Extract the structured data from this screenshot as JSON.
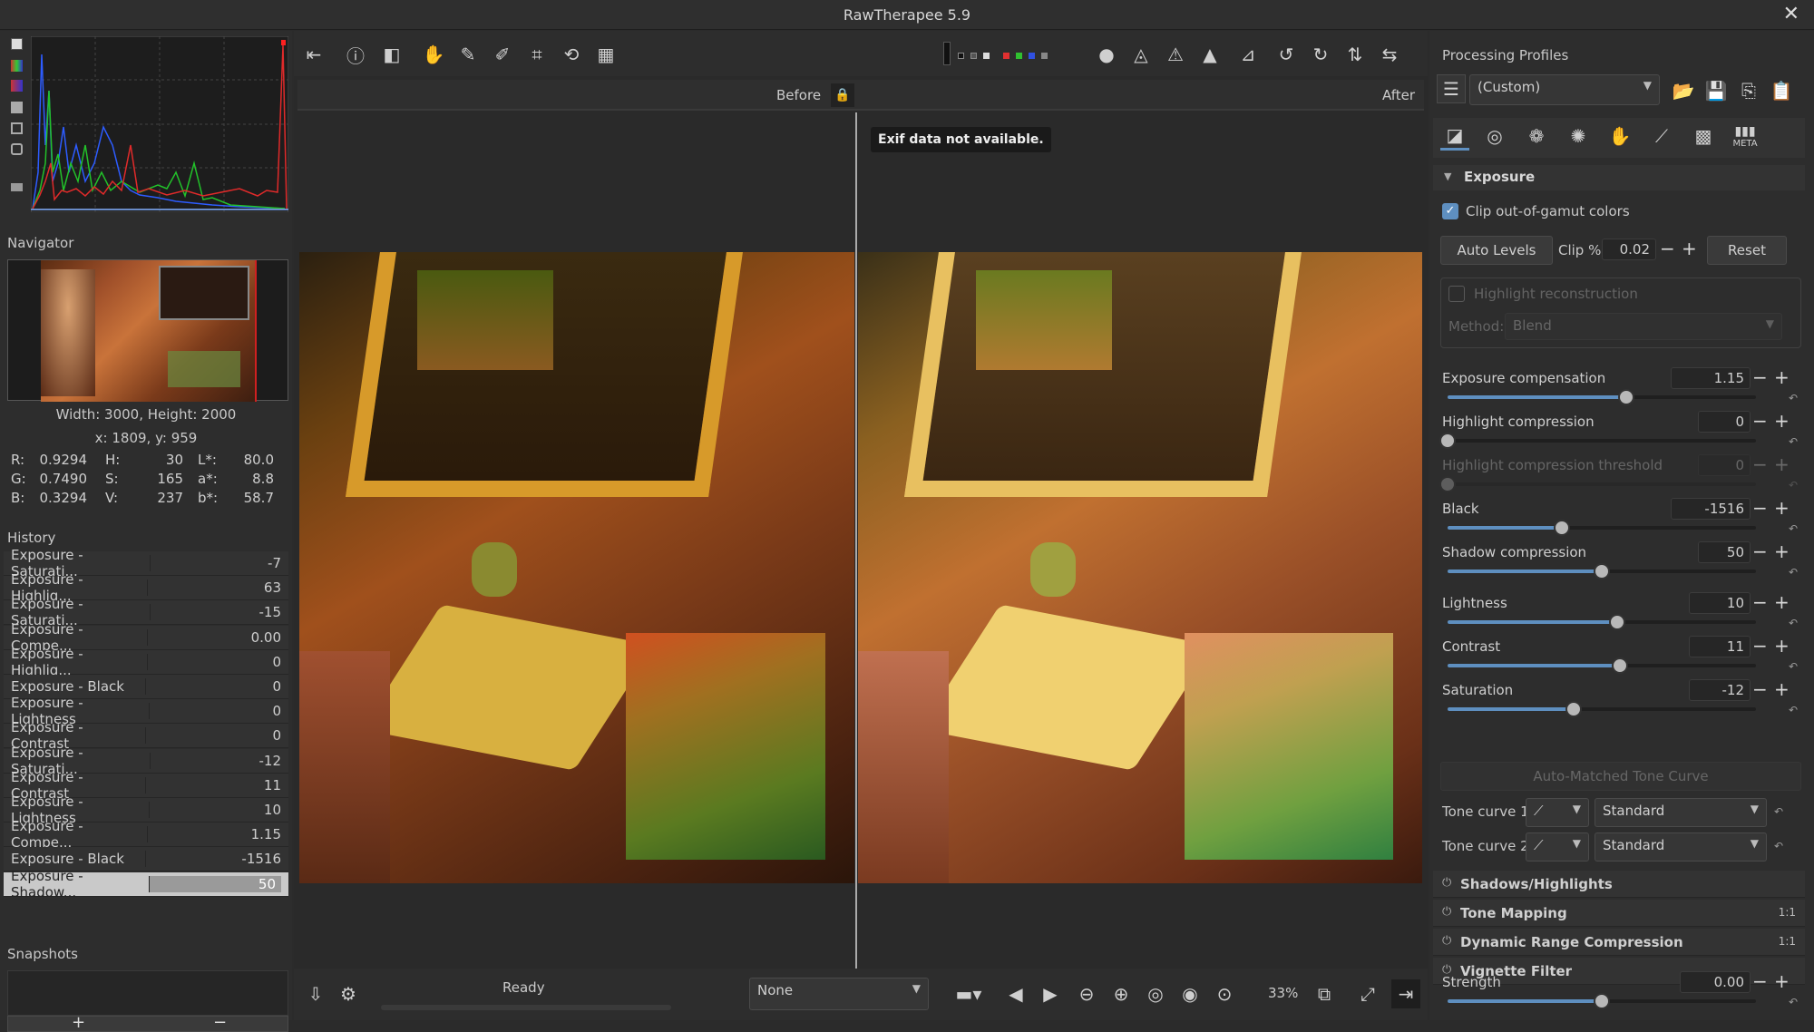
{
  "window": {
    "title": "RawTherapee 5.9",
    "close_glyph": "✕"
  },
  "navigator": {
    "title": "Navigator",
    "dims": "Width: 3000, Height: 2000",
    "coords": "x: 1809, y: 959",
    "r_label": "R:",
    "r_val": "0.9294",
    "g_label": "G:",
    "g_val": "0.7490",
    "b_label": "B:",
    "b_val": "0.3294",
    "h_label": "H:",
    "h_val": "30",
    "s_label": "S:",
    "s_val": "165",
    "v_label": "V:",
    "v_val": "237",
    "l_label": "L*:",
    "l_val": "80.0",
    "a_label": "a*:",
    "a_val": "8.8",
    "bb_label": "b*:",
    "bb_val": "58.7"
  },
  "history": {
    "title": "History",
    "items": [
      {
        "label": "Exposure - Saturati...",
        "value": "-7"
      },
      {
        "label": "Exposure - Highlig...",
        "value": "63"
      },
      {
        "label": "Exposure - Saturati...",
        "value": "-15"
      },
      {
        "label": "Exposure - Compe...",
        "value": "0.00"
      },
      {
        "label": "Exposure - Highlig...",
        "value": "0"
      },
      {
        "label": "Exposure - Black",
        "value": "0"
      },
      {
        "label": "Exposure - Lightness",
        "value": "0"
      },
      {
        "label": "Exposure - Contrast",
        "value": "0"
      },
      {
        "label": "Exposure - Saturati...",
        "value": "-12"
      },
      {
        "label": "Exposure - Contrast",
        "value": "11"
      },
      {
        "label": "Exposure - Lightness",
        "value": "10"
      },
      {
        "label": "Exposure - Compe...",
        "value": "1.15"
      },
      {
        "label": "Exposure - Black",
        "value": "-1516"
      },
      {
        "label": "Exposure - Shadow...",
        "value": "50"
      }
    ]
  },
  "snapshots": {
    "title": "Snapshots",
    "add": "+",
    "remove": "−"
  },
  "viewer": {
    "before_label": "Before",
    "after_label": "After",
    "exif_tooltip": "Exif data not available.",
    "status": "Ready",
    "zoom": "33%",
    "preview_select": "None"
  },
  "profiles": {
    "title": "Processing Profiles",
    "selected": "(Custom)"
  },
  "exposure": {
    "section_title": "Exposure",
    "clip_label": "Clip out-of-gamut colors",
    "auto_levels": "Auto Levels",
    "clip_pct_label": "Clip %",
    "clip_pct_value": "0.02",
    "reset": "Reset",
    "highlight_recon": "Highlight reconstruction",
    "method_label": "Method:",
    "method_value": "Blend",
    "exp_comp_label": "Exposure compensation",
    "exp_comp_value": "1.15",
    "exp_comp_level": 0.58,
    "hl_comp_label": "Highlight compression",
    "hl_comp_value": "0",
    "hl_comp_level": 0.0,
    "hl_thr_label": "Highlight compression threshold",
    "hl_thr_value": "0",
    "hl_thr_level": 0.0,
    "black_label": "Black",
    "black_value": "-1516",
    "black_level": 0.37,
    "shadow_label": "Shadow compression",
    "shadow_value": "50",
    "shadow_level": 0.5,
    "lightness_label": "Lightness",
    "lightness_value": "10",
    "lightness_level": 0.55,
    "contrast_label": "Contrast",
    "contrast_value": "11",
    "contrast_level": 0.56,
    "saturation_label": "Saturation",
    "saturation_value": "-12",
    "saturation_level": 0.41,
    "auto_matched": "Auto-Matched Tone Curve",
    "tone1_label": "Tone curve 1:",
    "tone1_value": "Standard",
    "tone2_label": "Tone curve 2:",
    "tone2_value": "Standard"
  },
  "folds": {
    "shadows": "Shadows/Highlights",
    "tonemap": "Tone Mapping",
    "tonemap_ratio": "1:1",
    "drc": "Dynamic Range Compression",
    "drc_ratio": "1:1",
    "vignette": "Vignette Filter"
  },
  "vignette": {
    "strength_label": "Strength",
    "strength_value": "0.00",
    "strength_level": 0.5
  },
  "tabs": {
    "meta": "META"
  },
  "colors": {
    "accent": "#5e8fc0",
    "bg": "#2b2b2b",
    "panel": "#2d2d2d"
  }
}
